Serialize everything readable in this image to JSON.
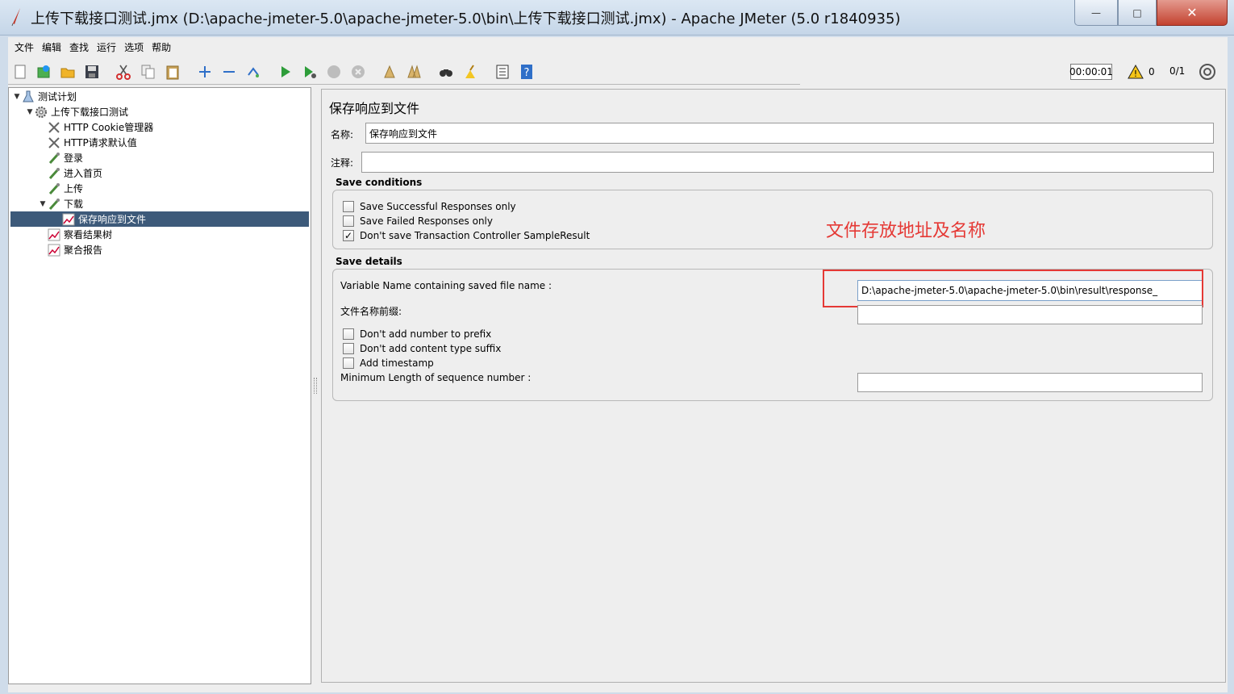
{
  "window": {
    "title": "上传下载接口测试.jmx (D:\\apache-jmeter-5.0\\apache-jmeter-5.0\\bin\\上传下载接口测试.jmx) - Apache JMeter (5.0 r1840935)",
    "minimize_glyph": "—",
    "maximize_glyph": "□",
    "close_glyph": "✕"
  },
  "menu": [
    "文件",
    "编辑",
    "查找",
    "运行",
    "选项",
    "帮助"
  ],
  "toolbar": {
    "icons": [
      "new-icon",
      "templates-icon",
      "open-icon",
      "save-icon",
      "cut-icon",
      "copy-icon",
      "paste-icon",
      "expand-icon",
      "collapse-icon",
      "toggle-icon",
      "start-icon",
      "start-no-pause-icon",
      "stop-icon",
      "shutdown-icon",
      "clear-icon",
      "clear-all-icon",
      "search-icon",
      "reset-search-icon",
      "function-helper-icon",
      "help-icon"
    ],
    "timer": "00:00:01",
    "warning_count": "0",
    "threads": "0/1"
  },
  "tree": [
    {
      "label": "测试计划",
      "icon": "test-plan-icon",
      "level": 0,
      "expanded": true
    },
    {
      "label": "上传下载接口测试",
      "icon": "thread-group-icon",
      "level": 1,
      "expanded": true
    },
    {
      "label": "HTTP Cookie管理器",
      "icon": "config-element-icon",
      "level": 2
    },
    {
      "label": "HTTP请求默认值",
      "icon": "config-element-icon",
      "level": 2
    },
    {
      "label": "登录",
      "icon": "sampler-icon",
      "level": 2
    },
    {
      "label": "进入首页",
      "icon": "sampler-icon",
      "level": 2
    },
    {
      "label": "上传",
      "icon": "sampler-icon",
      "level": 2
    },
    {
      "label": "下载",
      "icon": "sampler-icon",
      "level": 2,
      "expanded": true
    },
    {
      "label": "保存响应到文件",
      "icon": "listener-icon",
      "level": 3,
      "selected": true
    },
    {
      "label": "察看结果树",
      "icon": "listener-icon",
      "level": 2
    },
    {
      "label": "聚合报告",
      "icon": "listener-icon",
      "level": 2
    }
  ],
  "panel": {
    "title": "保存响应到文件",
    "name_label": "名称:",
    "name_value": "保存响应到文件",
    "comment_label": "注释:",
    "comment_value": "",
    "save_conditions": {
      "title": "Save conditions",
      "options": [
        {
          "label": "Save Successful Responses only",
          "checked": false
        },
        {
          "label": "Save Failed Responses only",
          "checked": false
        },
        {
          "label": "Don't save Transaction Controller SampleResult",
          "checked": true
        }
      ]
    },
    "save_details": {
      "title": "Save details",
      "variable_name_label": "Variable Name containing saved file name :",
      "file_path_value": "D:\\apache-jmeter-5.0\\apache-jmeter-5.0\\bin\\result\\response_",
      "prefix_label": "文件名称前缀:",
      "prefix_value": "",
      "options": [
        {
          "label": "Don't add number to prefix",
          "checked": false
        },
        {
          "label": "Don't add content type suffix",
          "checked": false
        },
        {
          "label": "Add timestamp",
          "checked": false
        }
      ],
      "min_length_label": "Minimum Length of sequence number :",
      "min_length_value": ""
    },
    "annotation": "文件存放地址及名称"
  },
  "colors": {
    "selection": "#3d5a7a",
    "annotation": "#e53935",
    "panel_bg": "#eeeeee"
  }
}
